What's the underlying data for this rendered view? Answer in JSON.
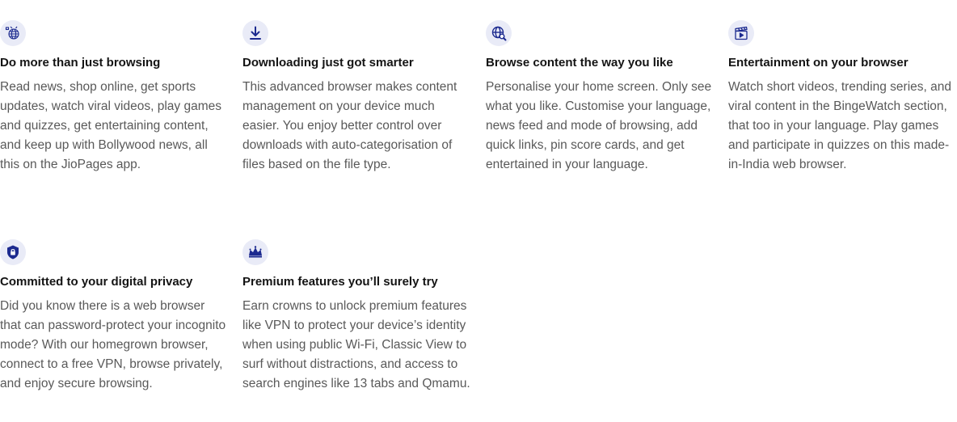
{
  "colors": {
    "icon_bg": "#e9ebf7",
    "icon_fg": "#1c2a8f",
    "title": "#141414",
    "text": "#595959"
  },
  "features": [
    {
      "icon": "globe-web-icon",
      "title": "Do more than just browsing",
      "description": "Read news, shop online, get sports updates, watch viral videos, play games and quizzes, get entertaining content, and keep up with Bollywood news, all this on the JioPages app."
    },
    {
      "icon": "download-icon",
      "title": "Downloading just got smarter",
      "description": "This advanced browser makes content management on your device much easier. You enjoy better control over downloads with auto-categorisation of files based on the file type."
    },
    {
      "icon": "globe-search-icon",
      "title": "Browse content the way you like",
      "description": "Personalise your home screen. Only see what you like. Customise your language, news feed and mode of browsing, add quick links, pin score cards, and get entertained in your language."
    },
    {
      "icon": "clapperboard-icon",
      "title": "Entertainment on your browser",
      "description": "Watch short videos, trending series, and viral content in the BingeWatch section, that too in your language. Play games and participate in quizzes on this made-in-India web browser."
    },
    {
      "icon": "shield-lock-icon",
      "title": "Committed to your digital privacy",
      "description": "Did you know there is a web browser that can password-protect your incognito mode? With our homegrown browser, connect to a free VPN, browse privately, and enjoy secure browsing."
    },
    {
      "icon": "crown-icon",
      "title": "Premium features you’ll surely try",
      "description": "Earn crowns to unlock premium features like VPN to protect your device’s identity when using public Wi-Fi, Classic View to surf without distractions, and access to search engines like 13 tabs and Qmamu."
    }
  ]
}
